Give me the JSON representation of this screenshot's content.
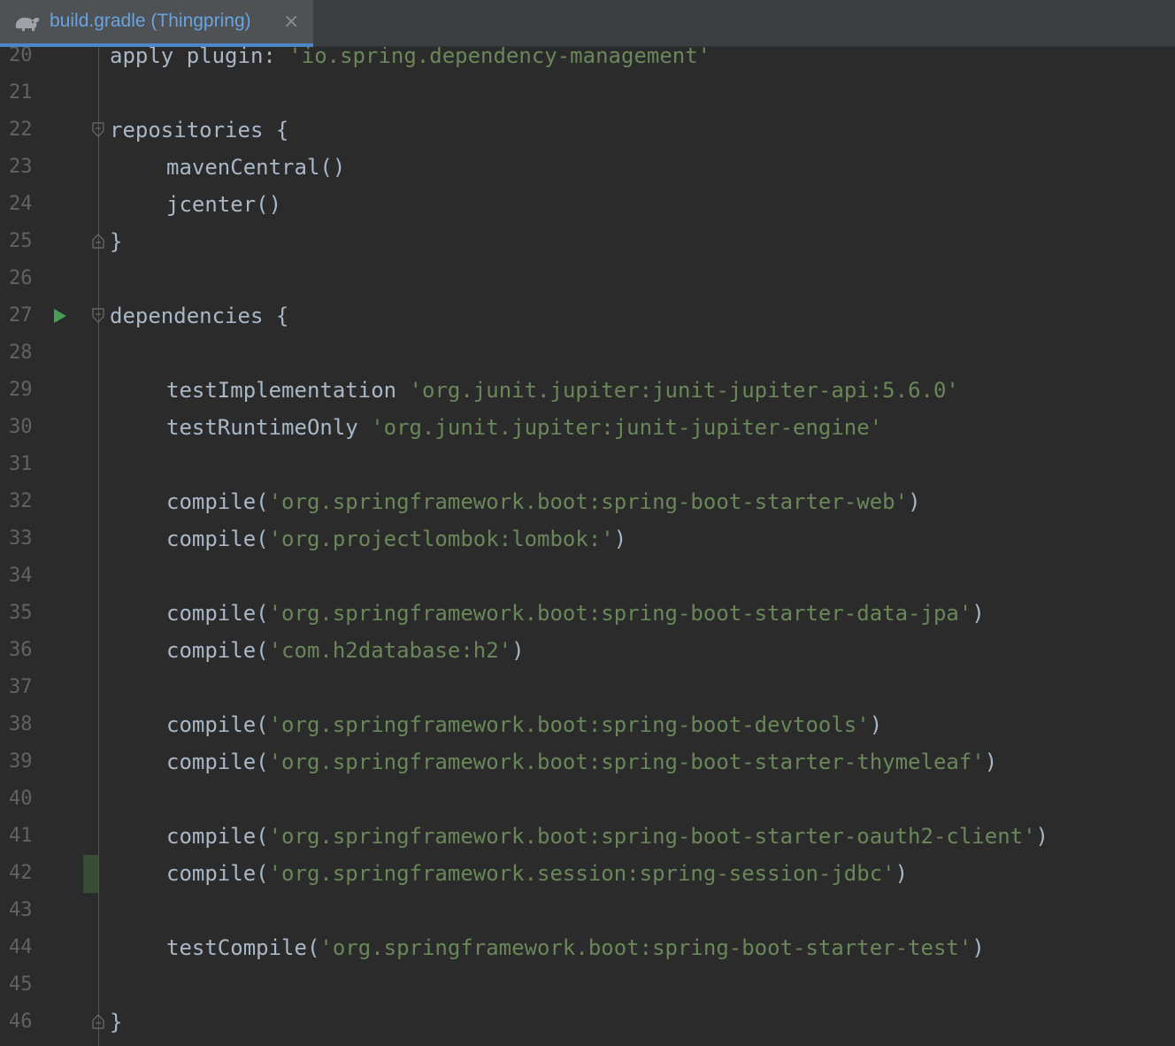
{
  "tab": {
    "title": "build.gradle (Thingpring)",
    "icon": "gradle-elephant-icon",
    "close_glyph": "×",
    "accent": "#4a88c7"
  },
  "colors": {
    "background": "#2b2b2b",
    "text": "#a9b7c6",
    "string": "#6a8759",
    "line_number": "#606366",
    "change_marker": "#384c38"
  },
  "lines": [
    {
      "num": "20",
      "parts": [
        {
          "t": "apply ",
          "s": "plain"
        },
        {
          "t": "plugin: ",
          "s": "plain"
        },
        {
          "t": "'io.spring.dependency-management'",
          "s": "str"
        }
      ]
    },
    {
      "num": "21",
      "parts": []
    },
    {
      "num": "22",
      "parts": [
        {
          "t": "repositories {",
          "s": "plain"
        }
      ]
    },
    {
      "num": "23",
      "parts": [
        {
          "t": "mavenCentral()",
          "s": "plain"
        }
      ]
    },
    {
      "num": "24",
      "parts": [
        {
          "t": "jcenter()",
          "s": "plain"
        }
      ]
    },
    {
      "num": "25",
      "parts": [
        {
          "t": "}",
          "s": "plain"
        }
      ]
    },
    {
      "num": "26",
      "parts": []
    },
    {
      "num": "27",
      "parts": [
        {
          "t": "dependencies {",
          "s": "plain"
        }
      ]
    },
    {
      "num": "28",
      "parts": []
    },
    {
      "num": "29",
      "parts": [
        {
          "t": "testImplementation ",
          "s": "plain"
        },
        {
          "t": "'org.junit.jupiter:junit-jupiter-api:5.6.0'",
          "s": "str"
        }
      ]
    },
    {
      "num": "30",
      "parts": [
        {
          "t": "testRuntimeOnly ",
          "s": "plain"
        },
        {
          "t": "'org.junit.jupiter:junit-jupiter-engine'",
          "s": "str"
        }
      ]
    },
    {
      "num": "31",
      "parts": []
    },
    {
      "num": "32",
      "parts": [
        {
          "t": "compile(",
          "s": "plain"
        },
        {
          "t": "'org.springframework.boot:spring-boot-starter-web'",
          "s": "str"
        },
        {
          "t": ")",
          "s": "plain"
        }
      ]
    },
    {
      "num": "33",
      "parts": [
        {
          "t": "compile(",
          "s": "plain"
        },
        {
          "t": "'org.projectlombok:lombok:'",
          "s": "str"
        },
        {
          "t": ")",
          "s": "plain"
        }
      ]
    },
    {
      "num": "34",
      "parts": []
    },
    {
      "num": "35",
      "parts": [
        {
          "t": "compile(",
          "s": "plain"
        },
        {
          "t": "'org.springframework.boot:spring-boot-starter-data-jpa'",
          "s": "str"
        },
        {
          "t": ")",
          "s": "plain"
        }
      ]
    },
    {
      "num": "36",
      "parts": [
        {
          "t": "compile(",
          "s": "plain"
        },
        {
          "t": "'com.h2database:h2'",
          "s": "str"
        },
        {
          "t": ")",
          "s": "plain"
        }
      ]
    },
    {
      "num": "37",
      "parts": []
    },
    {
      "num": "38",
      "parts": [
        {
          "t": "compile(",
          "s": "plain"
        },
        {
          "t": "'org.springframework.boot:spring-boot-devtools'",
          "s": "str"
        },
        {
          "t": ")",
          "s": "plain"
        }
      ]
    },
    {
      "num": "39",
      "parts": [
        {
          "t": "compile(",
          "s": "plain"
        },
        {
          "t": "'org.springframework.boot:spring-boot-starter-thymeleaf'",
          "s": "str"
        },
        {
          "t": ")",
          "s": "plain"
        }
      ]
    },
    {
      "num": "40",
      "parts": []
    },
    {
      "num": "41",
      "parts": [
        {
          "t": "compile(",
          "s": "plain"
        },
        {
          "t": "'org.springframework.boot:spring-boot-starter-oauth2-client'",
          "s": "str"
        },
        {
          "t": ")",
          "s": "plain"
        }
      ]
    },
    {
      "num": "42",
      "parts": [
        {
          "t": "compile(",
          "s": "plain"
        },
        {
          "t": "'org.springframework.session:spring-session-jdbc'",
          "s": "str"
        },
        {
          "t": ")",
          "s": "plain"
        }
      ]
    },
    {
      "num": "43",
      "parts": []
    },
    {
      "num": "44",
      "parts": [
        {
          "t": "testCompile(",
          "s": "plain"
        },
        {
          "t": "'org.springframework.boot:spring-boot-starter-test'",
          "s": "str"
        },
        {
          "t": ")",
          "s": "plain"
        }
      ]
    },
    {
      "num": "45",
      "parts": []
    },
    {
      "num": "46",
      "parts": [
        {
          "t": "}",
          "s": "plain"
        }
      ]
    }
  ]
}
